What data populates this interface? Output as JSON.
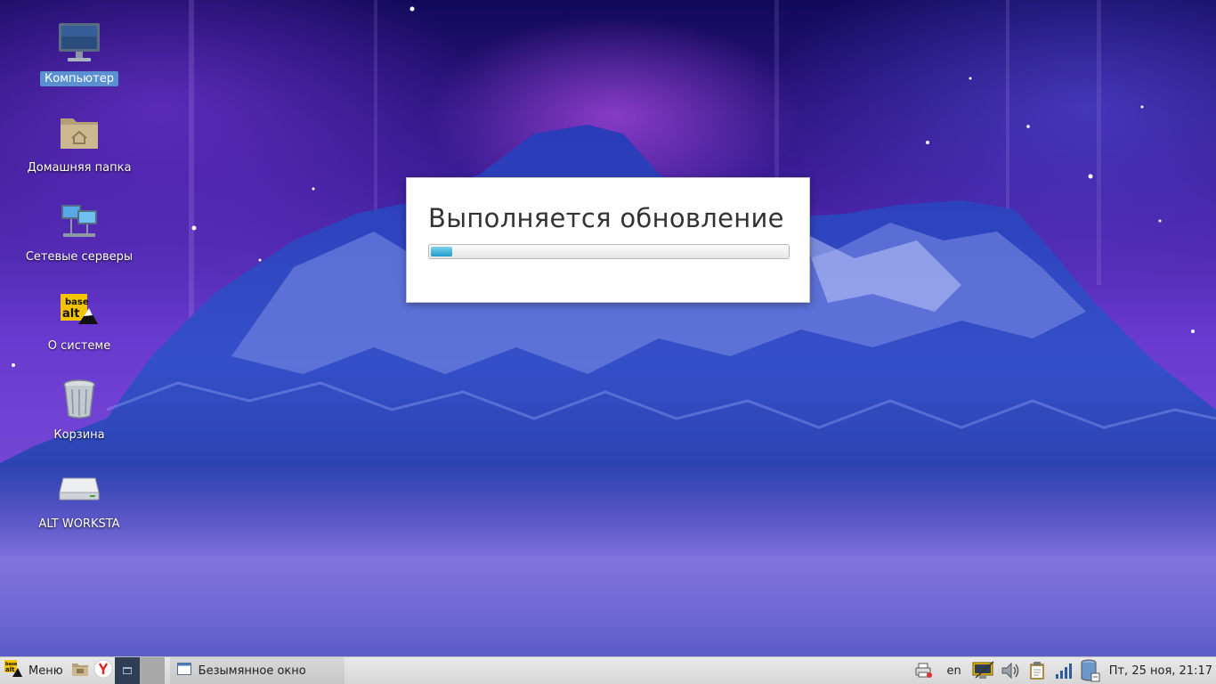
{
  "desktop": {
    "icons": [
      {
        "label": "Компьютер",
        "icon": "computer-icon",
        "selected": true
      },
      {
        "label": "Домашняя папка",
        "icon": "home-folder-icon"
      },
      {
        "label": "Сетевые серверы",
        "icon": "network-servers-icon"
      },
      {
        "label": "О системе",
        "icon": "basealt-logo-icon"
      },
      {
        "label": "Корзина",
        "icon": "trash-icon"
      },
      {
        "label": "ALT WORKSTA",
        "icon": "drive-icon"
      }
    ]
  },
  "dialog": {
    "title": "Выполняется обновление",
    "progress_fraction": 0.06,
    "progress_color": "#1e9bc6"
  },
  "taskbar": {
    "menu_label": "Меню",
    "launchers": [
      "file-manager-icon",
      "yandex-browser-icon"
    ],
    "task_label": "Безымянное окно",
    "language": "en",
    "clock": "Пт, 25 ноя, 21:17",
    "tray_icons": [
      "printer-icon",
      "display-settings-icon",
      "volume-icon",
      "clipboard-icon",
      "network-signal-icon",
      "battery-icon"
    ]
  }
}
